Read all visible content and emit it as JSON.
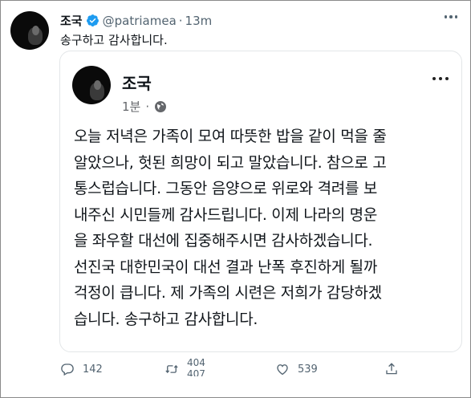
{
  "tweet": {
    "author_name": "조국",
    "handle": "@patriamea",
    "separator": "·",
    "time": "13m",
    "text": "송구하고 감사합니다.",
    "verified_icon": "verified-badge-icon"
  },
  "embed": {
    "author_name": "조국",
    "meta_time": "1분",
    "meta_separator": "·",
    "privacy_icon": "globe-icon",
    "body_lines": [
      "오늘 저녁은 가족이 모여 따뜻한 밥을 같이 먹을 줄",
      "알았으나, 헛된 희망이 되고 말았습니다. 참으로 고",
      "통스럽습니다. 그동안 음양으로 위로와 격려를 보",
      "내주신 시민들께 감사드립니다. 이제 나라의 명운",
      "을 좌우할 대선에 집중해주시면 감사하겠습니다.",
      "선진국 대한민국이 대선 결과 난폭 후진하게 될까",
      "걱정이 큽니다. 제 가족의 시련은 저희가 감당하겠",
      "습니다. 송구하고 감사합니다."
    ]
  },
  "actions": {
    "reply_count": "142",
    "retweet_count_top": "404",
    "retweet_count_bottom": "407",
    "like_count": "539",
    "share_label": ""
  },
  "colors": {
    "text_primary": "#0f1419",
    "text_secondary": "#536471",
    "verified": "#1d9bf0",
    "card_border": "#e3e6e8"
  }
}
